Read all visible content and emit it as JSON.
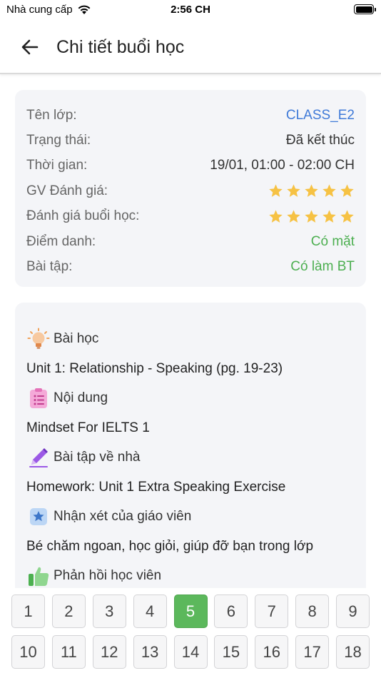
{
  "status_bar": {
    "carrier": "Nhà cung cấp",
    "time": "2:56 CH"
  },
  "header": {
    "title": "Chi tiết buổi học"
  },
  "info": {
    "class_label": "Tên lớp:",
    "class_value": "CLASS_E2",
    "status_label": "Trạng thái:",
    "status_value": "Đã kết thúc",
    "time_label": "Thời gian:",
    "time_value": "19/01, 01:00 - 02:00 CH",
    "teacher_rating_label": "GV Đánh giá:",
    "teacher_rating": 5,
    "session_rating_label": "Đánh giá buổi học:",
    "session_rating": 5,
    "attendance_label": "Điểm danh:",
    "attendance_value": "Có mặt",
    "homework_label": "Bài tập:",
    "homework_value": "Có làm BT"
  },
  "sections": {
    "lesson_title": "Bài học",
    "lesson_text": "Unit 1: Relationship - Speaking (pg. 19-23)",
    "content_title": "Nội dung",
    "content_text": "Mindset For IELTS 1",
    "homework_title": "Bài tập về nhà",
    "homework_text": "Homework: Unit 1 Extra Speaking Exercise",
    "teacher_comment_title": "Nhận xét của giáo viên",
    "teacher_comment_text": "Bé chăm ngoan, học giỏi, giúp đỡ bạn trong lớp",
    "student_feedback_title": "Phản hồi học viên"
  },
  "pager": {
    "row1": [
      "1",
      "2",
      "3",
      "4",
      "5",
      "6",
      "7",
      "8",
      "9"
    ],
    "row2": [
      "10",
      "11",
      "12",
      "13",
      "14",
      "15",
      "16",
      "17",
      "18"
    ],
    "active": "5"
  },
  "colors": {
    "accent_green": "#5cb85c",
    "link_blue": "#3f7ad8",
    "star": "#f6c244",
    "card_bg": "#f4f5f8"
  }
}
